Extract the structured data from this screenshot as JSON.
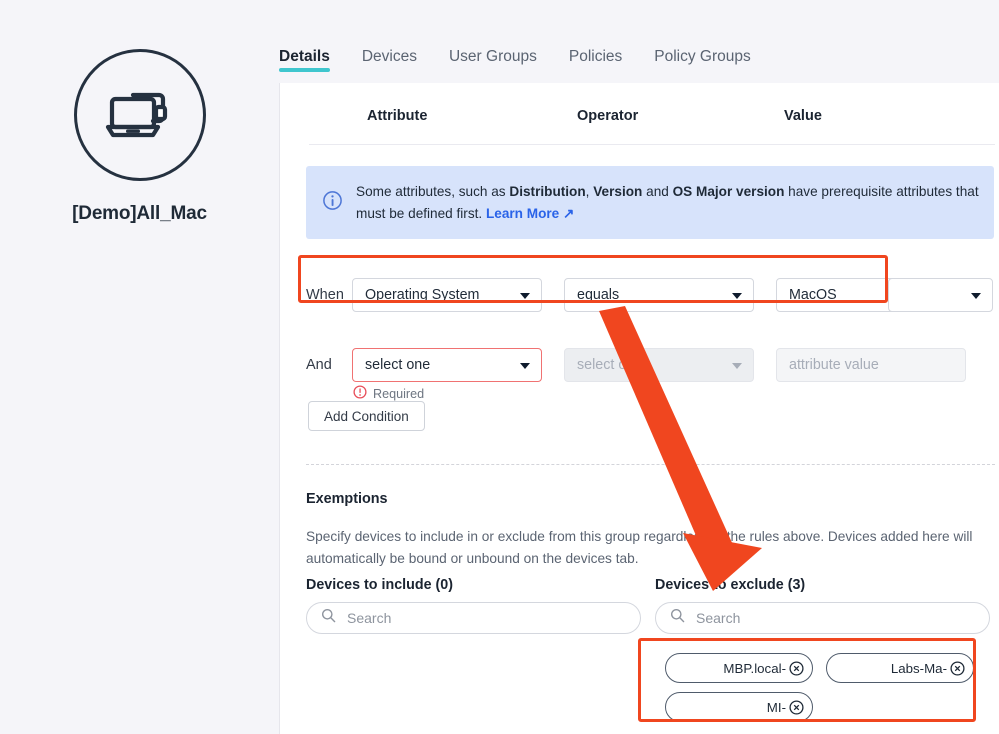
{
  "group": {
    "name": "[Demo]All_Mac",
    "avatar_icon": "laptop-device-icon"
  },
  "tabs": [
    {
      "label": "Details",
      "active": true
    },
    {
      "label": "Devices",
      "active": false
    },
    {
      "label": "User Groups",
      "active": false
    },
    {
      "label": "Policies",
      "active": false
    },
    {
      "label": "Policy Groups",
      "active": false
    }
  ],
  "columns": {
    "attribute": "Attribute",
    "operator": "Operator",
    "value": "Value"
  },
  "banner": {
    "icon": "info-circle-icon",
    "text_1": "Some attributes, such as ",
    "bold_1": "Distribution",
    "text_2": ", ",
    "bold_2": "Version",
    "text_3": " and ",
    "bold_3": "OS Major version",
    "text_4": " have prerequisite attributes that must be defined first. ",
    "link": "Learn More ↗"
  },
  "rules": {
    "when": {
      "conjunction": "When",
      "attribute": "Operating System",
      "operator": "equals",
      "value": "MacOS",
      "extra": ""
    },
    "and": {
      "conjunction": "And",
      "attribute": "select one",
      "operator": "select one",
      "value_placeholder": "attribute value",
      "error": "Required",
      "error_icon": "error-circle-icon"
    },
    "add_condition": "Add Condition"
  },
  "exemptions": {
    "title": "Exemptions",
    "description": "Specify devices to include in or exclude from this group regardless of the rules above. Devices added here will automatically be bound or unbound on the devices tab.",
    "include_label": "Devices to include (0)",
    "exclude_label": "Devices to exclude (3)",
    "search_placeholder": "Search",
    "search_icon": "search-icon",
    "excluded_devices": [
      {
        "label": "-MBP.local",
        "remove_icon": "remove-circle-icon"
      },
      {
        "label": "-Labs-Ma",
        "remove_icon": "remove-circle-icon"
      },
      {
        "label": "-MI",
        "remove_icon": "remove-circle-icon"
      }
    ]
  },
  "annotations": {
    "highlight_color": "#f0461f",
    "arrow_color": "#f0461f",
    "accent_teal": "#3fc6ce",
    "banner_bg": "#d7e3fb",
    "link_blue": "#2a63e8"
  }
}
